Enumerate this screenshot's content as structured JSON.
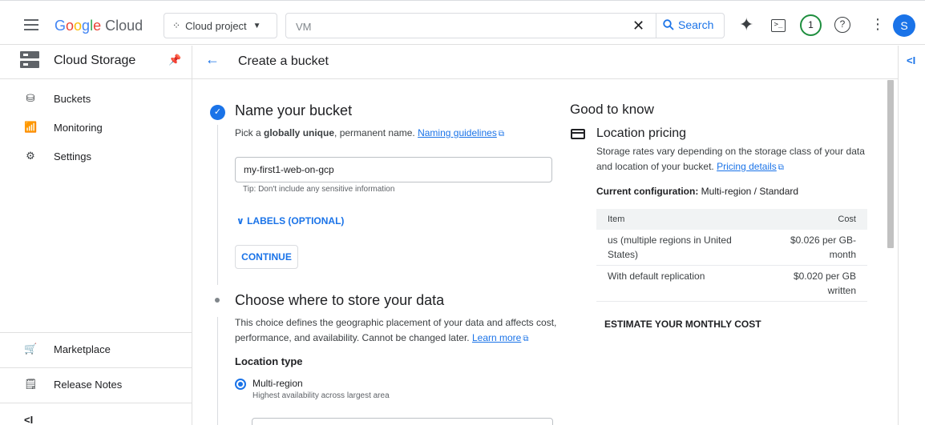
{
  "header": {
    "logo_google": [
      "G",
      "o",
      "o",
      "g",
      "l",
      "e"
    ],
    "logo_cloud": "Cloud",
    "project_label": "Cloud project",
    "search_value": "VM",
    "search_button": "Search",
    "notifications_count": "1",
    "avatar_initial": "S"
  },
  "sidebar": {
    "title": "Cloud Storage",
    "items": [
      {
        "label": "Buckets",
        "icon": "bucket-icon"
      },
      {
        "label": "Monitoring",
        "icon": "chart-icon"
      },
      {
        "label": "Settings",
        "icon": "gear-icon"
      }
    ],
    "bottom_items": [
      {
        "label": "Marketplace",
        "icon": "cart-icon"
      },
      {
        "label": "Release Notes",
        "icon": "notes-icon"
      }
    ],
    "collapse_label": "<I"
  },
  "page": {
    "title": "Create a bucket"
  },
  "step1": {
    "title": "Name your bucket",
    "desc_prefix": "Pick a ",
    "desc_bold": "globally unique",
    "desc_suffix": ", permanent name. ",
    "desc_link": "Naming guidelines",
    "bucket_name": "my-first1-web-on-gcp",
    "tip": "Tip: Don't include any sensitive information",
    "labels_toggle": "LABELS (OPTIONAL)",
    "continue": "CONTINUE"
  },
  "step2": {
    "title": "Choose where to store your data",
    "desc_line1": "This choice defines the geographic placement of your data and affects cost,",
    "desc_line2": "performance, and availability. Cannot be changed later. ",
    "desc_link": "Learn more",
    "location_type": "Location type",
    "option_label": "Multi-region",
    "option_sub": "Highest availability across largest area"
  },
  "good_to_know": {
    "title": "Good to know",
    "section_title": "Location pricing",
    "desc": "Storage rates vary depending on the storage class of your data and location of your bucket. ",
    "desc_link": "Pricing details",
    "config_label": "Current configuration:",
    "config_value": " Multi-region / Standard",
    "table": {
      "headers": [
        "Item",
        "Cost"
      ],
      "rows": [
        [
          "us (multiple regions in United States)",
          "$0.026 per GB-month"
        ],
        [
          "With default replication",
          "$0.020 per GB written"
        ]
      ]
    },
    "estimate": "ESTIMATE YOUR MONTHLY COST"
  }
}
